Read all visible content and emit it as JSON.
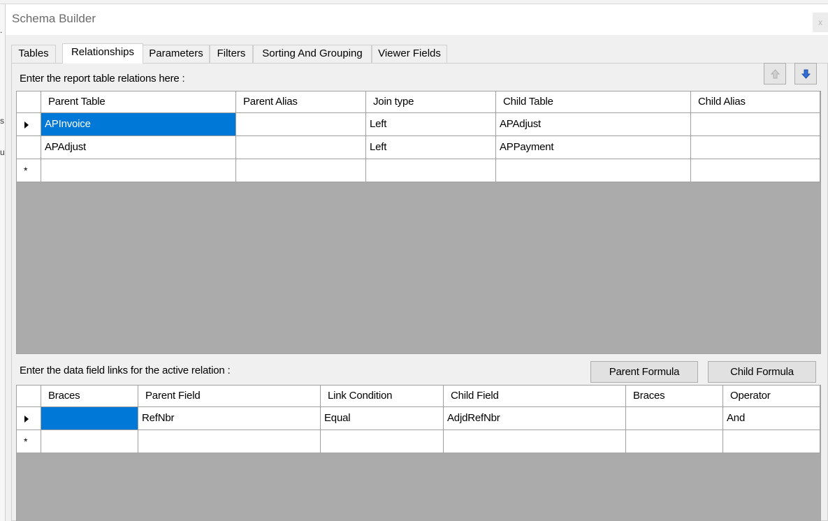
{
  "window": {
    "title": "Schema Builder",
    "close_label": "x"
  },
  "tabs": [
    "Tables",
    "Relationships",
    "Parameters",
    "Filters",
    "Sorting And Grouping",
    "Viewer Fields"
  ],
  "relations": {
    "hint": "Enter the report table relations here :",
    "columns": [
      "Parent Table",
      "Parent Alias",
      "Join type",
      "Child Table",
      "Child Alias"
    ],
    "rows": [
      [
        "APInvoice",
        "",
        "Left",
        "APAdjust",
        ""
      ],
      [
        "APAdjust",
        "",
        "Left",
        "APPayment",
        ""
      ]
    ],
    "new_row_marker": "*"
  },
  "links": {
    "hint": "Enter the data field links for the active relation :",
    "parent_formula_label": "Parent Formula",
    "child_formula_label": "Child Formula",
    "columns": [
      "Braces",
      "Parent Field",
      "Link Condition",
      "Child Field",
      "Braces",
      "Operator"
    ],
    "rows": [
      [
        "",
        "RefNbr",
        "Equal",
        "AdjdRefNbr",
        "",
        "And"
      ]
    ],
    "new_row_marker": "*"
  },
  "icons": {
    "move_up": "arrow-up-icon",
    "move_down": "arrow-down-icon",
    "selected_accent": "#0078d7",
    "down_arrow_color": "#2f6fd6",
    "up_arrow_color": "#b8b8b8"
  }
}
